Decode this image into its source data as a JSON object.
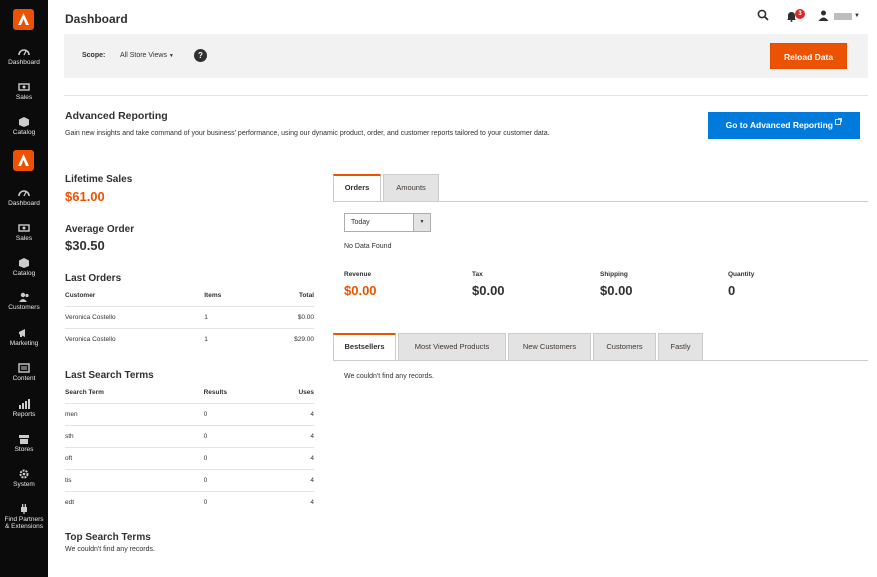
{
  "colors": {
    "accent": "#eb5202",
    "primary_button": "#007bdb",
    "sidebar": "#0b0b0b"
  },
  "sidebar": {
    "items": [
      {
        "label": "Dashboard",
        "icon": "dashboard-icon"
      },
      {
        "label": "Sales",
        "icon": "sales-icon"
      },
      {
        "label": "Catalog",
        "icon": "catalog-icon"
      },
      {
        "label": "Dashboard",
        "icon": "dashboard-icon"
      },
      {
        "label": "Sales",
        "icon": "sales-icon"
      },
      {
        "label": "Catalog",
        "icon": "catalog-icon"
      },
      {
        "label": "Customers",
        "icon": "customers-icon"
      },
      {
        "label": "Marketing",
        "icon": "marketing-icon"
      },
      {
        "label": "Content",
        "icon": "content-icon"
      },
      {
        "label": "Reports",
        "icon": "reports-icon"
      },
      {
        "label": "Stores",
        "icon": "stores-icon"
      },
      {
        "label": "System",
        "icon": "system-icon"
      },
      {
        "label_line1": "Find Partners",
        "label_line2": "& Extensions",
        "icon": "extensions-icon"
      }
    ]
  },
  "header": {
    "title": "Dashboard",
    "notification_count": "3"
  },
  "scope": {
    "label": "Scope:",
    "value": "All Store Views",
    "help": "?",
    "reload_label": "Reload Data"
  },
  "advanced": {
    "title": "Advanced Reporting",
    "description": "Gain new insights and take command of your business' performance, using our dynamic product, order, and customer reports tailored to your customer data.",
    "button_label": "Go to Advanced Reporting"
  },
  "stats": {
    "lifetime_label": "Lifetime Sales",
    "lifetime_value": "$61.00",
    "average_label": "Average Order",
    "average_value": "$30.50"
  },
  "last_orders": {
    "title": "Last Orders",
    "headers": [
      "Customer",
      "Items",
      "Total"
    ],
    "rows": [
      [
        "Veronica Costello",
        "1",
        "$0.00"
      ],
      [
        "Veronica Costello",
        "1",
        "$29.00"
      ]
    ]
  },
  "last_search": {
    "title": "Last Search Terms",
    "headers": [
      "Search Term",
      "Results",
      "Uses"
    ],
    "rows": [
      [
        "men",
        "0",
        "4"
      ],
      [
        "sth",
        "0",
        "4"
      ],
      [
        "oft",
        "0",
        "4"
      ],
      [
        "tis",
        "0",
        "4"
      ],
      [
        "edt",
        "0",
        "4"
      ]
    ]
  },
  "top_search": {
    "title": "Top Search Terms",
    "empty": "We couldn't find any records."
  },
  "chart_tabs": {
    "orders": "Orders",
    "amounts": "Amounts"
  },
  "period": {
    "value": "Today"
  },
  "no_data": "No Data Found",
  "totals": [
    {
      "label": "Revenue",
      "value": "$0.00"
    },
    {
      "label": "Tax",
      "value": "$0.00"
    },
    {
      "label": "Shipping",
      "value": "$0.00"
    },
    {
      "label": "Quantity",
      "value": "0"
    }
  ],
  "grid_tabs": [
    "Bestsellers",
    "Most Viewed Products",
    "New Customers",
    "Customers",
    "Fastly"
  ],
  "grid_empty": "We couldn't find any records."
}
